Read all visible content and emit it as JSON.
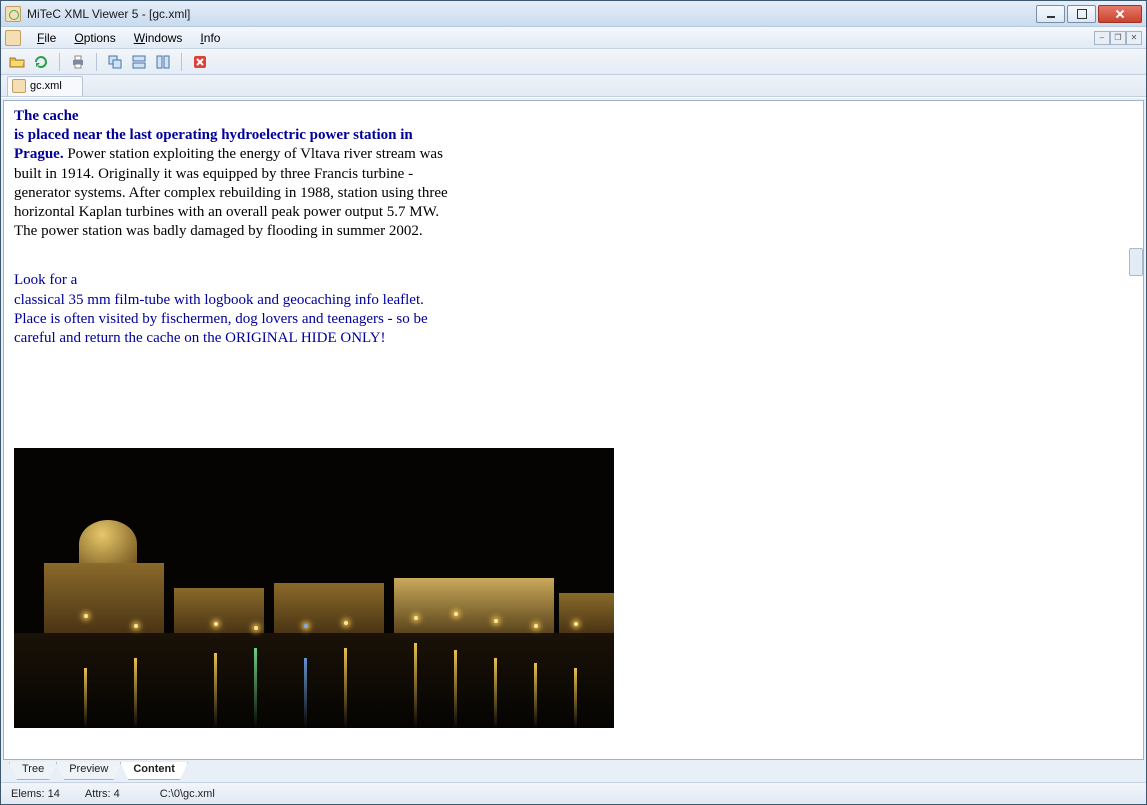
{
  "title": "MiTeC XML Viewer 5 - [gc.xml]",
  "menu": {
    "file": "File",
    "options": "Options",
    "windows": "Windows",
    "info": "Info"
  },
  "toolbar_icons": [
    "open",
    "refresh",
    "print",
    "cascade",
    "tile-h",
    "tile-v",
    "close-doc"
  ],
  "doc_tab": {
    "label": "gc.xml"
  },
  "content": {
    "p1_blue_bold": "The cache\nis placed near the last operating hydroelectric power station in Prague.",
    "p1_rest": " Power station exploiting the energy of Vltava river stream was built in 1914. Originally it was equipped by three Francis turbine - generator systems. After complex rebuilding in 1988, station using three horizontal Kaplan turbines with an overall peak power output 5.7 MW. The power station was badly damaged by flooding in summer 2002.",
    "p2_blue": "Look for a\nclassical 35 mm film-tube with logbook and geocaching info leaflet. Place is often visited by fischermen, dog lovers and teenagers - so be careful and return the cache on the ORIGINAL HIDE ONLY!"
  },
  "bottom_tabs": {
    "tree": "Tree",
    "preview": "Preview",
    "content": "Content"
  },
  "status": {
    "elems": "Elems: 14",
    "attrs": "Attrs: 4",
    "path": "C:\\0\\gc.xml"
  }
}
